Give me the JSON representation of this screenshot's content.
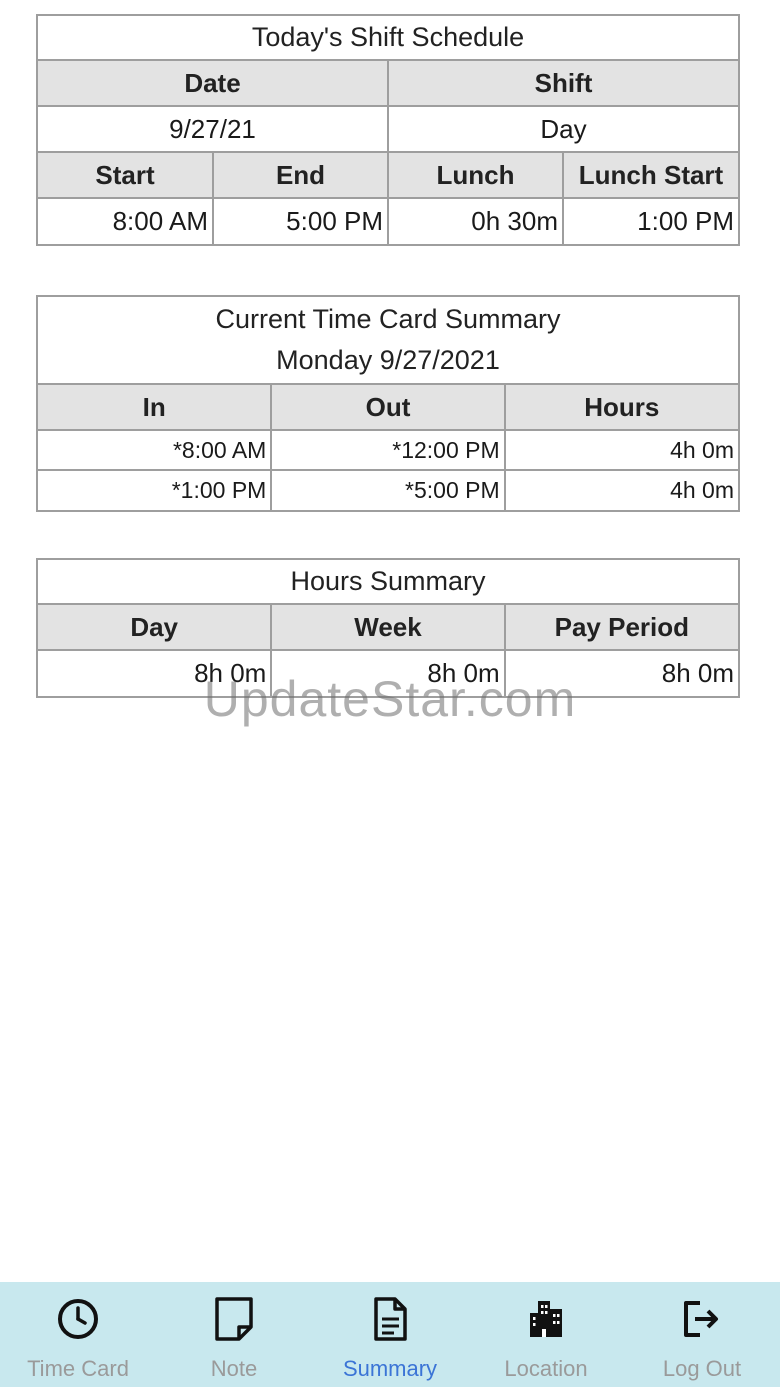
{
  "shift_schedule": {
    "title": "Today's Shift Schedule",
    "headers": {
      "date": "Date",
      "shift": "Shift"
    },
    "date": "9/27/21",
    "shift": "Day",
    "time_headers": [
      "Start",
      "End",
      "Lunch",
      "Lunch Start"
    ],
    "time_values": [
      "8:00 AM",
      "5:00 PM",
      "0h 30m",
      "1:00 PM"
    ]
  },
  "time_card": {
    "title": "Current Time Card Summary",
    "subtitle": "Monday 9/27/2021",
    "headers": [
      "In",
      "Out",
      "Hours"
    ],
    "rows": [
      [
        "*8:00 AM",
        "*12:00 PM",
        "4h 0m"
      ],
      [
        "*1:00 PM",
        "*5:00 PM",
        "4h 0m"
      ]
    ]
  },
  "hours_summary": {
    "title": "Hours Summary",
    "headers": [
      "Day",
      "Week",
      "Pay Period"
    ],
    "values": [
      "8h 0m",
      "8h 0m",
      "8h 0m"
    ]
  },
  "watermark": "UpdateStar.com",
  "nav": {
    "items": [
      {
        "label": "Time Card",
        "icon": "clock-icon"
      },
      {
        "label": "Note",
        "icon": "note-icon"
      },
      {
        "label": "Summary",
        "icon": "document-icon"
      },
      {
        "label": "Location",
        "icon": "building-icon"
      },
      {
        "label": "Log Out",
        "icon": "logout-icon"
      }
    ],
    "active_index": 2,
    "active_color": "#3b74d6",
    "background": "#c8e8ee"
  }
}
